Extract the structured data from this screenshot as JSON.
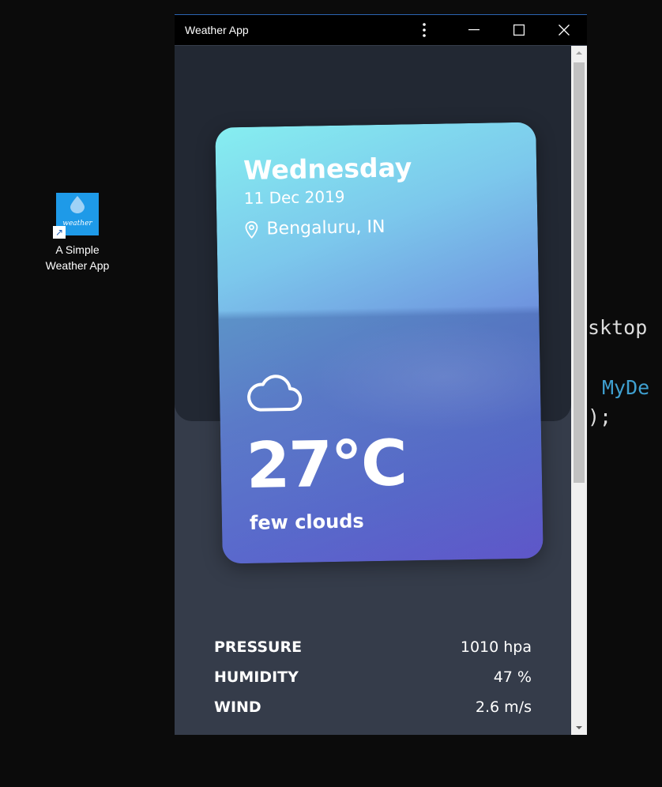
{
  "desktop": {
    "shortcut": {
      "icon_text": "weather",
      "label_line1": "A Simple",
      "label_line2": "Weather App"
    },
    "code_bg": {
      "line1": "sktop",
      "line2": "MyDe",
      "line3": ");"
    }
  },
  "window": {
    "title": "Weather App",
    "buttons": [
      "more-icon",
      "minimize-icon",
      "maximize-icon",
      "close-icon"
    ]
  },
  "weather": {
    "day": "Wednesday",
    "date": "11 Dec 2019",
    "location": "Bengaluru, IN",
    "icon": "cloud-icon",
    "temperature": "27°C",
    "description": "few clouds"
  },
  "stats": [
    {
      "label": "PRESSURE",
      "value": "1010 hpa"
    },
    {
      "label": "HUMIDITY",
      "value": "47 %"
    },
    {
      "label": "WIND",
      "value": "2.6 m/s"
    }
  ],
  "colors": {
    "window_bg": "#353c4a",
    "top_panel": "#222833",
    "card_gradient_start": "#86eef0",
    "card_gradient_end": "#6a5fd3",
    "shortcut_icon": "#1e9ae8"
  }
}
